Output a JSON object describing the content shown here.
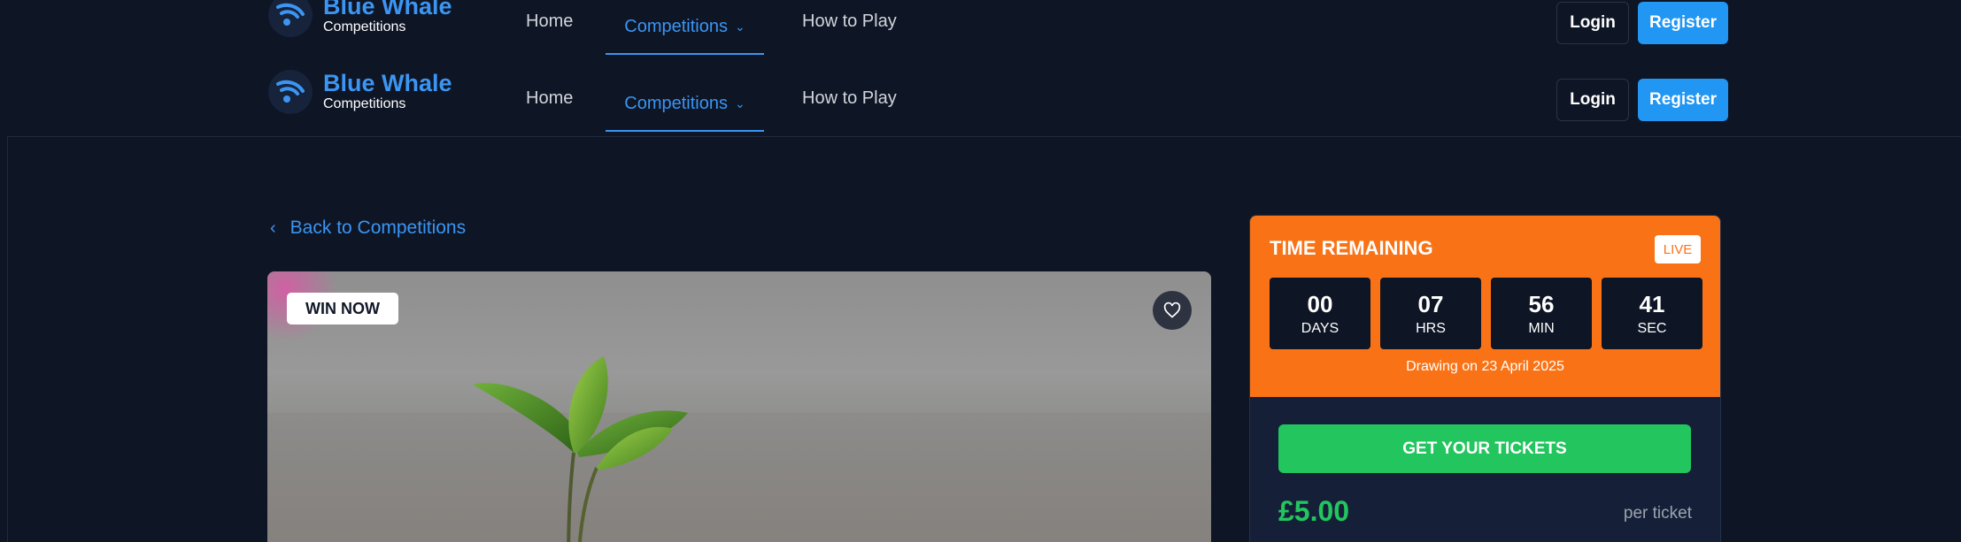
{
  "nav": {
    "brand_title": "Blue Whale",
    "brand_sub": "Competitions",
    "links": [
      {
        "label": "Home"
      },
      {
        "label": "Competitions",
        "active": true
      },
      {
        "label": "How to Play"
      }
    ],
    "login_label": "Login",
    "register_label": "Register"
  },
  "back_link": "Back to Competitions",
  "image_card": {
    "badge": "WIN NOW",
    "favorite_icon": "heart-icon"
  },
  "timer": {
    "title": "TIME REMAINING",
    "live_label": "LIVE",
    "units": [
      {
        "value": "00",
        "label": "DAYS"
      },
      {
        "value": "07",
        "label": "HRS"
      },
      {
        "value": "56",
        "label": "MIN"
      },
      {
        "value": "41",
        "label": "SEC"
      }
    ],
    "drawing_text": "Drawing on 23 April 2025"
  },
  "purchase": {
    "button_label": "GET YOUR TICKETS",
    "price": "£5.00",
    "price_unit": "per ticket"
  },
  "colors": {
    "background": "#0e1525",
    "accent_blue": "#2196f3",
    "timer_orange": "#f97316",
    "cta_green": "#22c55e"
  }
}
